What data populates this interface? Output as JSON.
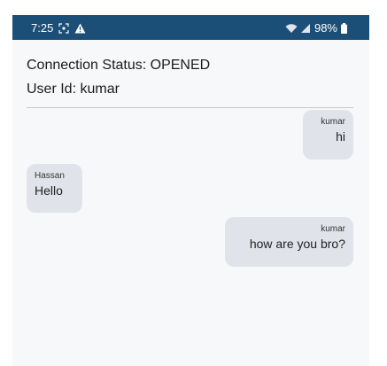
{
  "status_bar": {
    "time": "7:25",
    "left_icons": [
      "screenshot-icon",
      "warning-icon"
    ],
    "right_icons": [
      "wifi-icon",
      "signal-icon"
    ],
    "battery": "98%",
    "background_color": "#1c4f77"
  },
  "header": {
    "connection_status": "Connection Status: OPENED",
    "user_id": "User Id: kumar"
  },
  "messages": [
    {
      "sender": "kumar",
      "text": "hi",
      "mine": true
    },
    {
      "sender": "Hassan",
      "text": "Hello",
      "mine": false
    },
    {
      "sender": "kumar",
      "text": "how are you bro?",
      "mine": true
    }
  ],
  "colors": {
    "bubble": "#e0e3e9",
    "background": "#f7f8fa"
  }
}
